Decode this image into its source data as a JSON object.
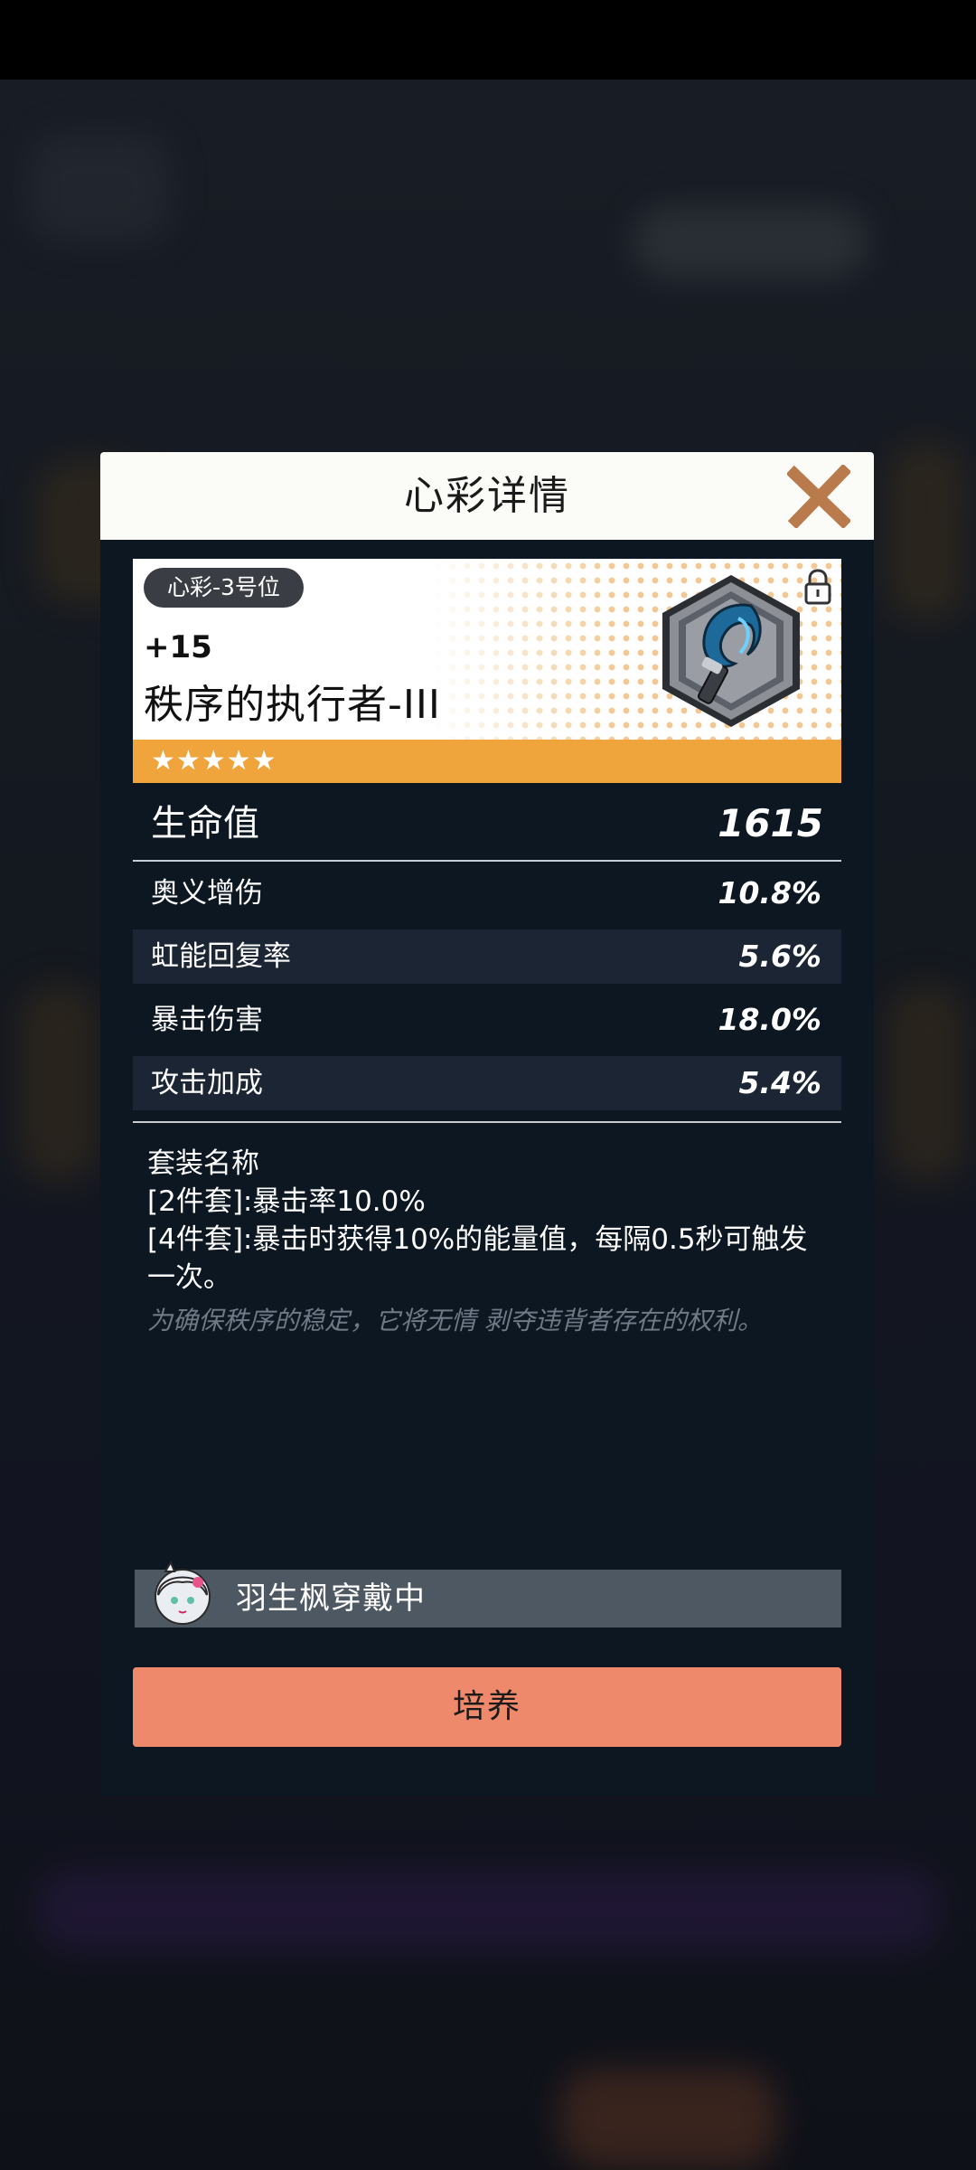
{
  "modal": {
    "title": "心彩详情"
  },
  "item": {
    "slot_tag": "心彩-3号位",
    "level": "+15",
    "name": "秩序的执行者-III",
    "stars": "★★★★★",
    "star_count": 5,
    "emblem_icon": "blue-sickle-hexagon-emblem",
    "lock_icon": "lock-icon"
  },
  "main_stat": {
    "label": "生命值",
    "value": "1615"
  },
  "sub_stats": [
    {
      "label": "奥义增伤",
      "value": "10.8%"
    },
    {
      "label": "虹能回复率",
      "value": "5.6%"
    },
    {
      "label": "暴击伤害",
      "value": "18.0%"
    },
    {
      "label": "攻击加成",
      "value": "5.4%"
    }
  ],
  "set": {
    "title": "套装名称",
    "bonus_2": "[2件套]:暴击率10.0%",
    "bonus_4": "[4件套]:暴击时获得10%的能量值，每隔0.5秒可触发一次。",
    "flavor": "为确保秩序的稳定，它将无情 剥夺违背者存在的权利。"
  },
  "wearer": {
    "label": "羽生枫穿戴中"
  },
  "buttons": {
    "train": "培养"
  },
  "colors": {
    "accent_orange": "#f0a43c",
    "button": "#ee8a6b",
    "panel": "#0d1722",
    "close": "#b97a4c"
  }
}
